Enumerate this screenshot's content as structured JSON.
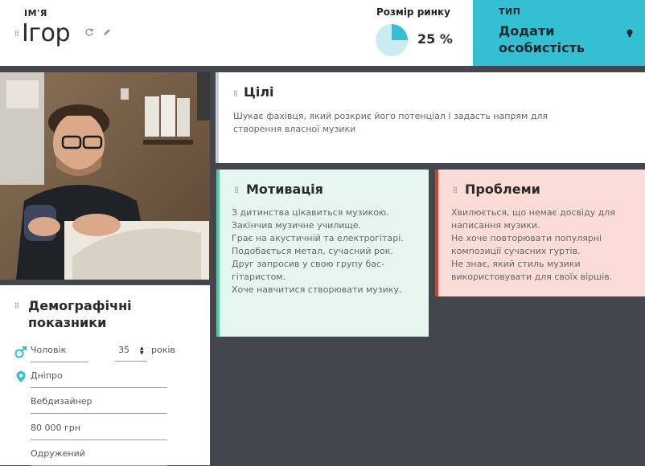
{
  "header": {
    "name_label": "ІМ'Я",
    "name": "Ігор",
    "market_label": "Розмір ринку",
    "market_value": "25 %",
    "market_share": 0.25,
    "type_label": "ТИП",
    "type_value": "Додати особистість"
  },
  "demographics": {
    "title": "Демографічні показники",
    "gender": "Чоловік",
    "age": "35",
    "age_suffix": "років",
    "city": "Дніпро",
    "occupation": "Вебдизайнер",
    "income": "80 000 грн",
    "marital_status": "Одружений"
  },
  "goals": {
    "title": "Цілі",
    "lines": [
      "Шукає фахівця, який розкриє його потенціал і задасть напрям для",
      "створення власної музики"
    ]
  },
  "motivation": {
    "title": "Мотивація",
    "lines": [
      "З дитинства цікавиться музикою.",
      "Закінчив музичне училище.",
      "Грає на акустичній та електрогітарі.",
      "Подобається метал, сучасний рок.",
      "Друг запросив у свою групу бас-",
      "гітаристом.",
      "Хоче навчитися створювати музику."
    ]
  },
  "problems": {
    "title": "Проблеми",
    "lines": [
      "Хвилюється, що немає досвіду для",
      "написання музики.",
      "Не хоче повторювати популярні",
      "композиції сучасних гуртів.",
      "Не знає, який стиль музики",
      "використовувати для своїх віршів."
    ]
  },
  "colors": {
    "accent": "#35bfd2",
    "background": "#43464d",
    "motivation_bg": "#e6f7f2",
    "motivation_border": "#4ccba5",
    "problems_bg": "#fbdcd7",
    "problems_border": "#d2402e"
  },
  "icons": {
    "refresh": "refresh-icon",
    "edit": "pencil-icon",
    "bulb": "lightbulb-icon",
    "gender": "male-symbol-icon",
    "location": "location-pin-icon",
    "drag": "drag-handle-icon"
  }
}
